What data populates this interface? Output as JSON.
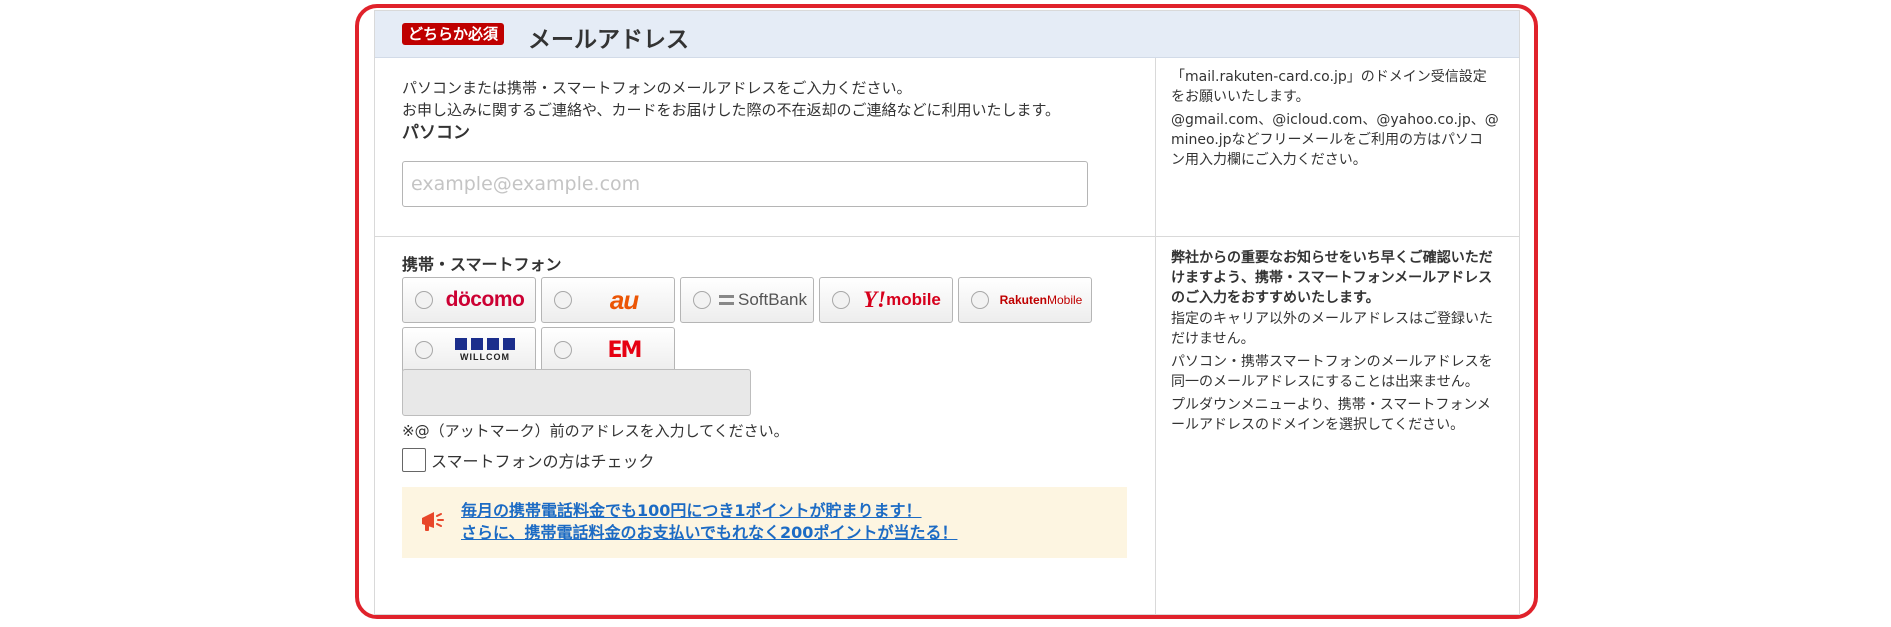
{
  "section": {
    "badge": "どちらか必須",
    "title": "メールアドレス"
  },
  "pc": {
    "desc_line1": "パソコンまたは携帯・スマートフォンのメールアドレスをご入力ください。",
    "desc_line2": "お申し込みに関するご連絡や、カードをお届けした際の不在返却のご連絡などに利用いたします。",
    "label": "パソコン",
    "placeholder": "example@example.com",
    "side_line1": "「mail.rakuten-card.co.jp」のドメイン受信設定",
    "side_line2": "をお願いいたします。",
    "side_line3": "@gmail.com、@icloud.com、@yahoo.co.jp、@",
    "side_line4": "mineo.jpなどフリーメールをご利用の方はパソコ",
    "side_line5": "ン用入力欄にご入力ください。"
  },
  "mobile": {
    "label": "携帯・スマートフォン",
    "carriers": [
      {
        "name": "docomo",
        "logo_text": "döcomo"
      },
      {
        "name": "au",
        "logo_text": "au"
      },
      {
        "name": "SoftBank",
        "logo_text": "SoftBank"
      },
      {
        "name": "Y!mobile",
        "logo_y": "Y!",
        "logo_text": "mobile"
      },
      {
        "name": "Rakuten Mobile",
        "logo_text": "Rakuten",
        "logo_sub": "Mobile"
      },
      {
        "name": "WILLCOM",
        "logo_text": "WILLCOM"
      },
      {
        "name": "EM",
        "logo_text": "EM"
      }
    ],
    "note": "※@（アットマーク）前のアドレスを入力してください。",
    "checkbox_label": "スマートフォンの方はチェック",
    "promo_line1": "毎月の携帯電話料金でも100円につき1ポイントが貯まります！",
    "promo_line2": "さらに、携帯電話料金のお支払いでもれなく200ポイントが当たる！",
    "side_bold1": "弊社からの重要なお知らせをいち早くご確認いただ",
    "side_bold2": "けますよう、携帯・スマートフォンメールアドレス",
    "side_bold3": "のご入力をおすすめいたします。",
    "side_p1_l1": "指定のキャリア以外のメールアドレスはご登録いた",
    "side_p1_l2": "だけません。",
    "side_p2_l1": "パソコン・携帯スマートフォンのメールアドレスを",
    "side_p2_l2": "同一のメールアドレスにすることは出来ません。",
    "side_p3_l1": "プルダウンメニューより、携帯・スマートフォンメ",
    "side_p3_l2": "ールアドレスのドメインを選択してください。"
  },
  "colors": {
    "highlight": "#e0222b",
    "badge": "#bf0000",
    "header_bg": "#e5ecf6",
    "link": "#1c6bc4",
    "promo_bg": "#fdf5e1"
  }
}
